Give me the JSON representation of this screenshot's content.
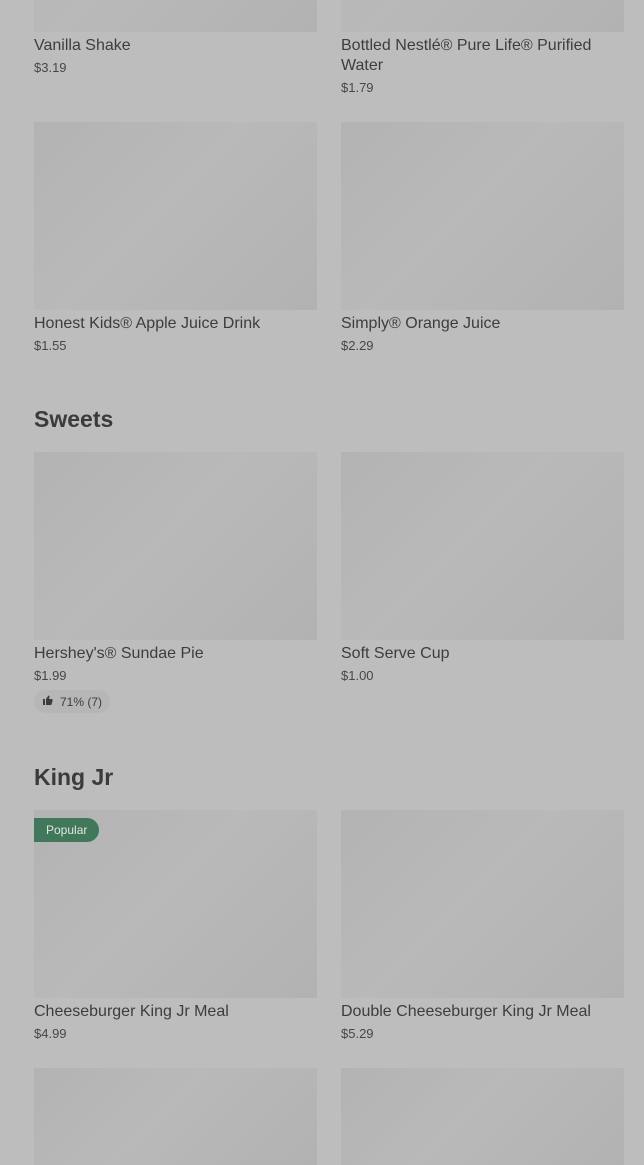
{
  "items": [
    {
      "name": "Vanilla Shake",
      "price": "$3.19"
    },
    {
      "name": "Bottled Nestlé® Pure Life® Purified Water",
      "price": "$1.79"
    },
    {
      "name": "Honest Kids® Apple Juice Drink",
      "price": "$1.55"
    },
    {
      "name": "Simply® Orange Juice",
      "price": "$2.29"
    }
  ],
  "sections": {
    "sweets": {
      "title": "Sweets",
      "items": [
        {
          "name": "Hershey's® Sundae Pie",
          "price": "$1.99",
          "rating": "71% (7)"
        },
        {
          "name": "Soft Serve Cup",
          "price": "$1.00"
        }
      ]
    },
    "king_jr": {
      "title": "King Jr",
      "items": [
        {
          "name": "Cheeseburger King Jr Meal",
          "price": "$4.99",
          "badge": "Popular"
        },
        {
          "name": "Double Cheeseburger King Jr Meal",
          "price": "$5.29"
        }
      ]
    }
  },
  "colors": {
    "background": "#bdbdbd",
    "image_placeholder": "#b5b5b5",
    "popular_badge": "#41775a"
  }
}
